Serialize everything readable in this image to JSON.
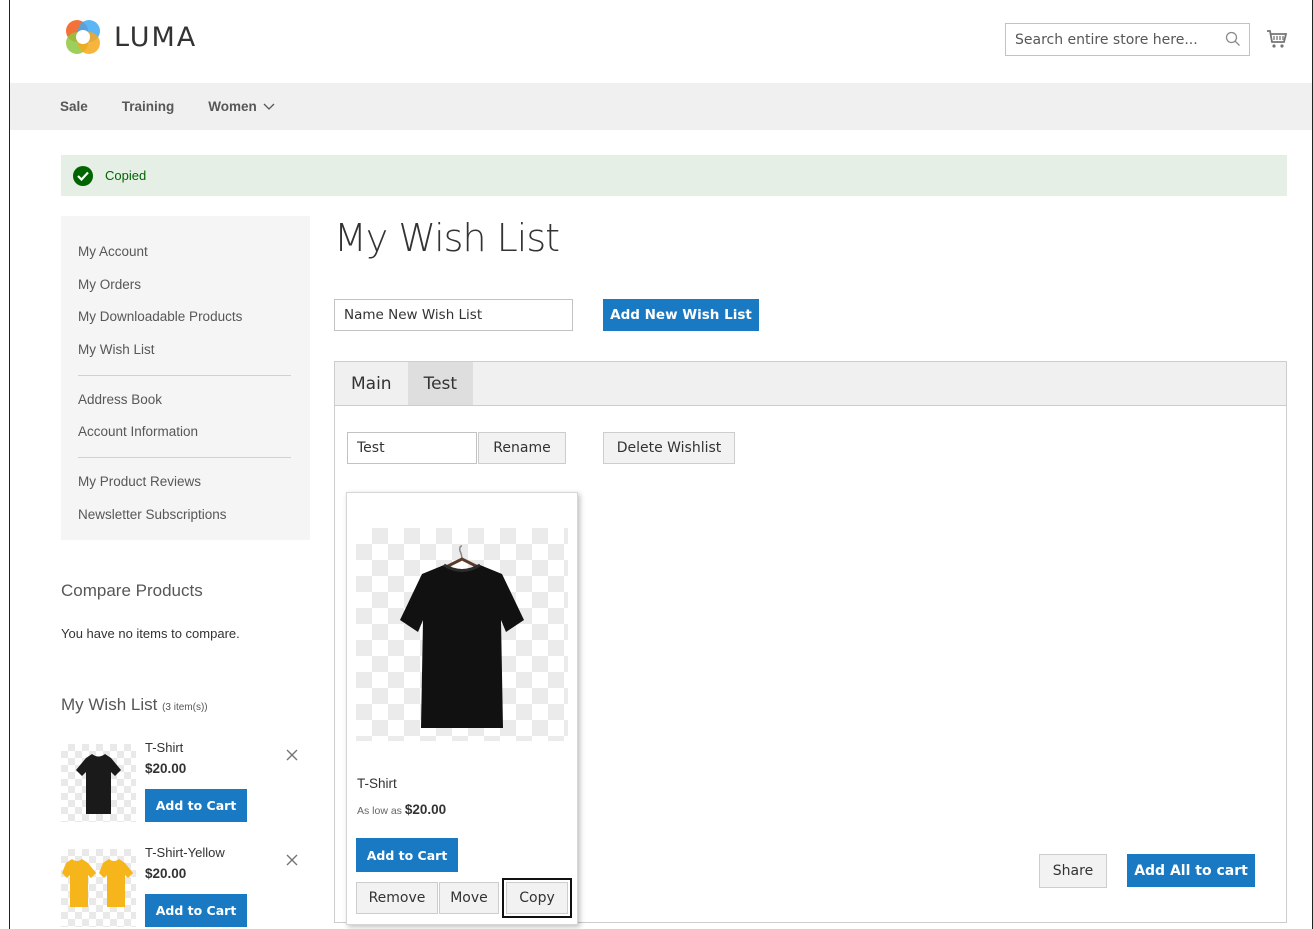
{
  "header": {
    "logo_text": "LUMA",
    "search_placeholder": "Search entire store here..."
  },
  "nav": {
    "items": [
      "Sale",
      "Training",
      "Women"
    ]
  },
  "message": {
    "text": "Copied"
  },
  "sidebar": {
    "group1": [
      "My Account",
      "My Orders",
      "My Downloadable Products",
      "My Wish List"
    ],
    "group2": [
      "Address Book",
      "Account Information"
    ],
    "group3": [
      "My Product Reviews",
      "Newsletter Subscriptions"
    ]
  },
  "compare": {
    "title": "Compare Products",
    "empty_text": "You have no items to compare."
  },
  "wishlist_sidebar": {
    "title": "My Wish List",
    "count": "(3 item(s))",
    "items": [
      {
        "name": "T-Shirt",
        "price": "$20.00",
        "button": "Add to Cart"
      },
      {
        "name": "T-Shirt-Yellow",
        "price": "$20.00",
        "button": "Add to Cart"
      }
    ]
  },
  "main": {
    "title": "My Wish List",
    "new_wishlist_placeholder": "Name New Wish List",
    "add_new_button": "Add New Wish List",
    "tabs": [
      "Main",
      "Test"
    ],
    "active_tab": "Test",
    "rename_value": "Test",
    "rename_button": "Rename",
    "delete_button": "Delete Wishlist",
    "product": {
      "name": "T-Shirt",
      "price_prefix": "As low as",
      "price": "$20.00",
      "add_button": "Add to Cart",
      "remove_button": "Remove",
      "move_button": "Move",
      "copy_button": "Copy"
    },
    "share_button": "Share",
    "add_all_button": "Add All to cart"
  },
  "colors": {
    "primary": "#1979c3",
    "success_bg": "#e5efe5",
    "success_text": "#006400",
    "nav_bg": "#f0f0f0"
  }
}
